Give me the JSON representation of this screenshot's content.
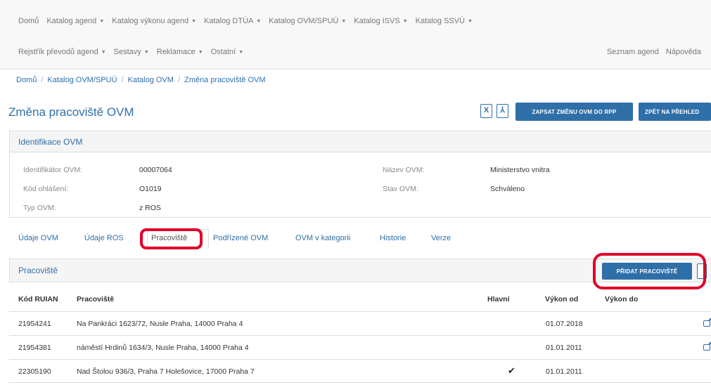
{
  "navbar": {
    "row1": [
      {
        "label": "Domů",
        "caret": false
      },
      {
        "label": "Katalog agend",
        "caret": true
      },
      {
        "label": "Katalog výkonu agend",
        "caret": true
      },
      {
        "label": "Katalog DTÚA",
        "caret": true
      },
      {
        "label": "Katalog OVM/SPUÚ",
        "caret": true
      },
      {
        "label": "Katalog ISVS",
        "caret": true
      },
      {
        "label": "Katalog SSVÚ",
        "caret": true
      }
    ],
    "row2": [
      {
        "label": "Rejstřík převodů agend",
        "caret": true
      },
      {
        "label": "Sestavy",
        "caret": true
      },
      {
        "label": "Reklamace",
        "caret": true
      },
      {
        "label": "Ostatní",
        "caret": true
      }
    ],
    "right": [
      "Seznam agend",
      "Nápověda"
    ]
  },
  "breadcrumb": [
    "Domů",
    "Katalog OVM/SPUÚ",
    "Katalog OVM",
    "Změna pracoviště OVM"
  ],
  "page_title": "Změna pracoviště OVM",
  "toolbar": {
    "xls_icon_glyph": "X",
    "pdf_icon_glyph": "⅄",
    "save_label": "ZAPSAT ZMĚNU OVM DO RPP",
    "back_label": "ZPĚT NA PŘEHLED"
  },
  "identification": {
    "heading": "Identifikace OVM",
    "fields": {
      "id_label": "Identifikátor OVM:",
      "id_value": "00007064",
      "code_label": "Kód ohlášení:",
      "code_value": "O1019",
      "type_label": "Typ OVM:",
      "type_value": "z ROS",
      "name_label": "Název OVM:",
      "name_value": "Ministerstvo vnitra",
      "state_label": "Stav OVM:",
      "state_value": "Schváleno"
    }
  },
  "tabs": [
    "Údaje OVM",
    "Údaje ROS",
    "Pracoviště",
    "Podřízené OVM",
    "OVM v kategorii",
    "Historie",
    "Verze"
  ],
  "active_tab": "Pracoviště",
  "workplaces": {
    "heading": "Pracoviště",
    "add_label": "PŘIDAT PRACOVIŠTĚ",
    "columns": [
      "Kód RUIAN",
      "Pracoviště",
      "Hlavní",
      "Výkon od",
      "Výkon do"
    ],
    "rows": [
      {
        "ruian": "21954241",
        "address": "Na Pankráci 1623/72, Nusle Praha, 14000 Praha 4",
        "main": "",
        "from": "01.07.2018",
        "to": ""
      },
      {
        "ruian": "21954381",
        "address": "náměstí Hrdinů 1634/3, Nusle Praha, 14000 Praha 4",
        "main": "",
        "from": "01.01.2011",
        "to": ""
      },
      {
        "ruian": "22305190",
        "address": "Nad Štolou 936/3, Praha 7 Holešovice, 17000 Praha 7",
        "main": "✔",
        "from": "01.01.2011",
        "to": ""
      }
    ]
  },
  "colors": {
    "accent": "#2f6fa8",
    "highlight": "#e0002a"
  }
}
